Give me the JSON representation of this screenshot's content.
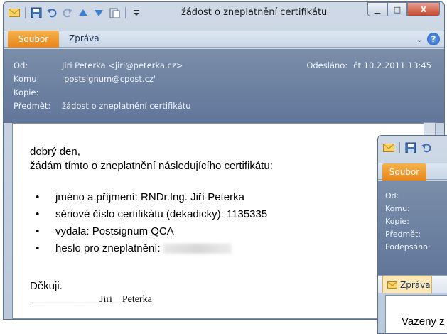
{
  "main": {
    "title": "žádost o zneplatnění certifikátu",
    "winbtns": {
      "min": "▁",
      "max": "□",
      "close": "X"
    },
    "tabs": {
      "file": "Soubor",
      "message": "Zpráva"
    },
    "help_glyph": "?",
    "collapse_glyph": "⌄",
    "header": {
      "from_label": "Od:",
      "from_value": "Jiri Peterka <jiri@peterka.cz>",
      "to_label": "Komu:",
      "to_value": "'postsignum@cpost.cz'",
      "cc_label": "Kopie:",
      "subject_label": "Předmět:",
      "subject_value": "žádost o zneplatnění certifikátu",
      "sent_label": "Odesláno:",
      "sent_value": "čt 10.2.2011 13:45"
    },
    "body": {
      "greeting": "dobrý den,",
      "intro": "žádám tímto o zneplatnění následujícího certifikátu:",
      "items": [
        "jméno a příjmení: RNDr.Ing. Jiří Peterka",
        "sériové číslo certifikátu (dekadicky): 1135335",
        "vydala: Postsignum QCA",
        "heslo pro zneplatnění:"
      ],
      "thanks": "Děkuji.",
      "signature": "______________Jiri__Peterka"
    }
  },
  "second": {
    "tabs": {
      "file": "Soubor",
      "message": "Zpráva"
    },
    "header": {
      "from_label": "Od:",
      "to_label": "Komu:",
      "cc_label": "Kopie:",
      "subject_label": "Předmět:",
      "signed_label": "Podepsáno:"
    },
    "body_text": "Vazeny z"
  },
  "icons": [
    "envelope-icon",
    "save-icon",
    "undo-icon",
    "redo-icon",
    "up-arrow-icon",
    "down-arrow-icon",
    "paste-icon",
    "dropdown-icon",
    "help-icon",
    "chevron-down-icon",
    "scroll-arrow-icon"
  ]
}
